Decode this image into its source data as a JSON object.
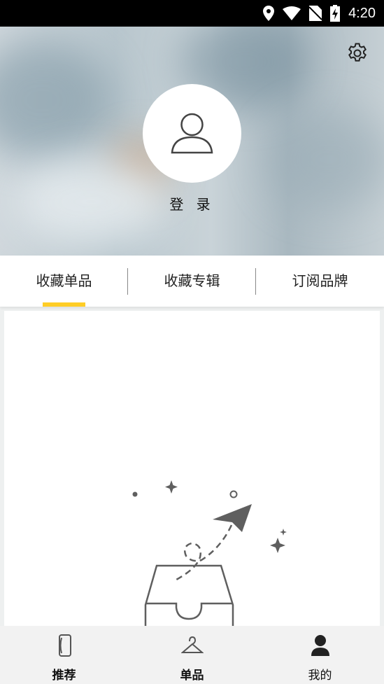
{
  "status_bar": {
    "time": "4:20"
  },
  "header": {
    "login_label": "登 录"
  },
  "tabs": [
    {
      "label": "收藏单品",
      "active": true
    },
    {
      "label": "收藏专辑",
      "active": false
    },
    {
      "label": "订阅品牌",
      "active": false
    }
  ],
  "bottom_nav": [
    {
      "label": "推荐",
      "icon": "phone-outline-icon",
      "active": false
    },
    {
      "label": "单品",
      "icon": "hanger-icon",
      "active": false
    },
    {
      "label": "我的",
      "icon": "person-icon",
      "active": true
    }
  ],
  "colors": {
    "accent": "#ffcd26",
    "status_bar": "#000000",
    "nav_bg": "#f2f2f2"
  }
}
